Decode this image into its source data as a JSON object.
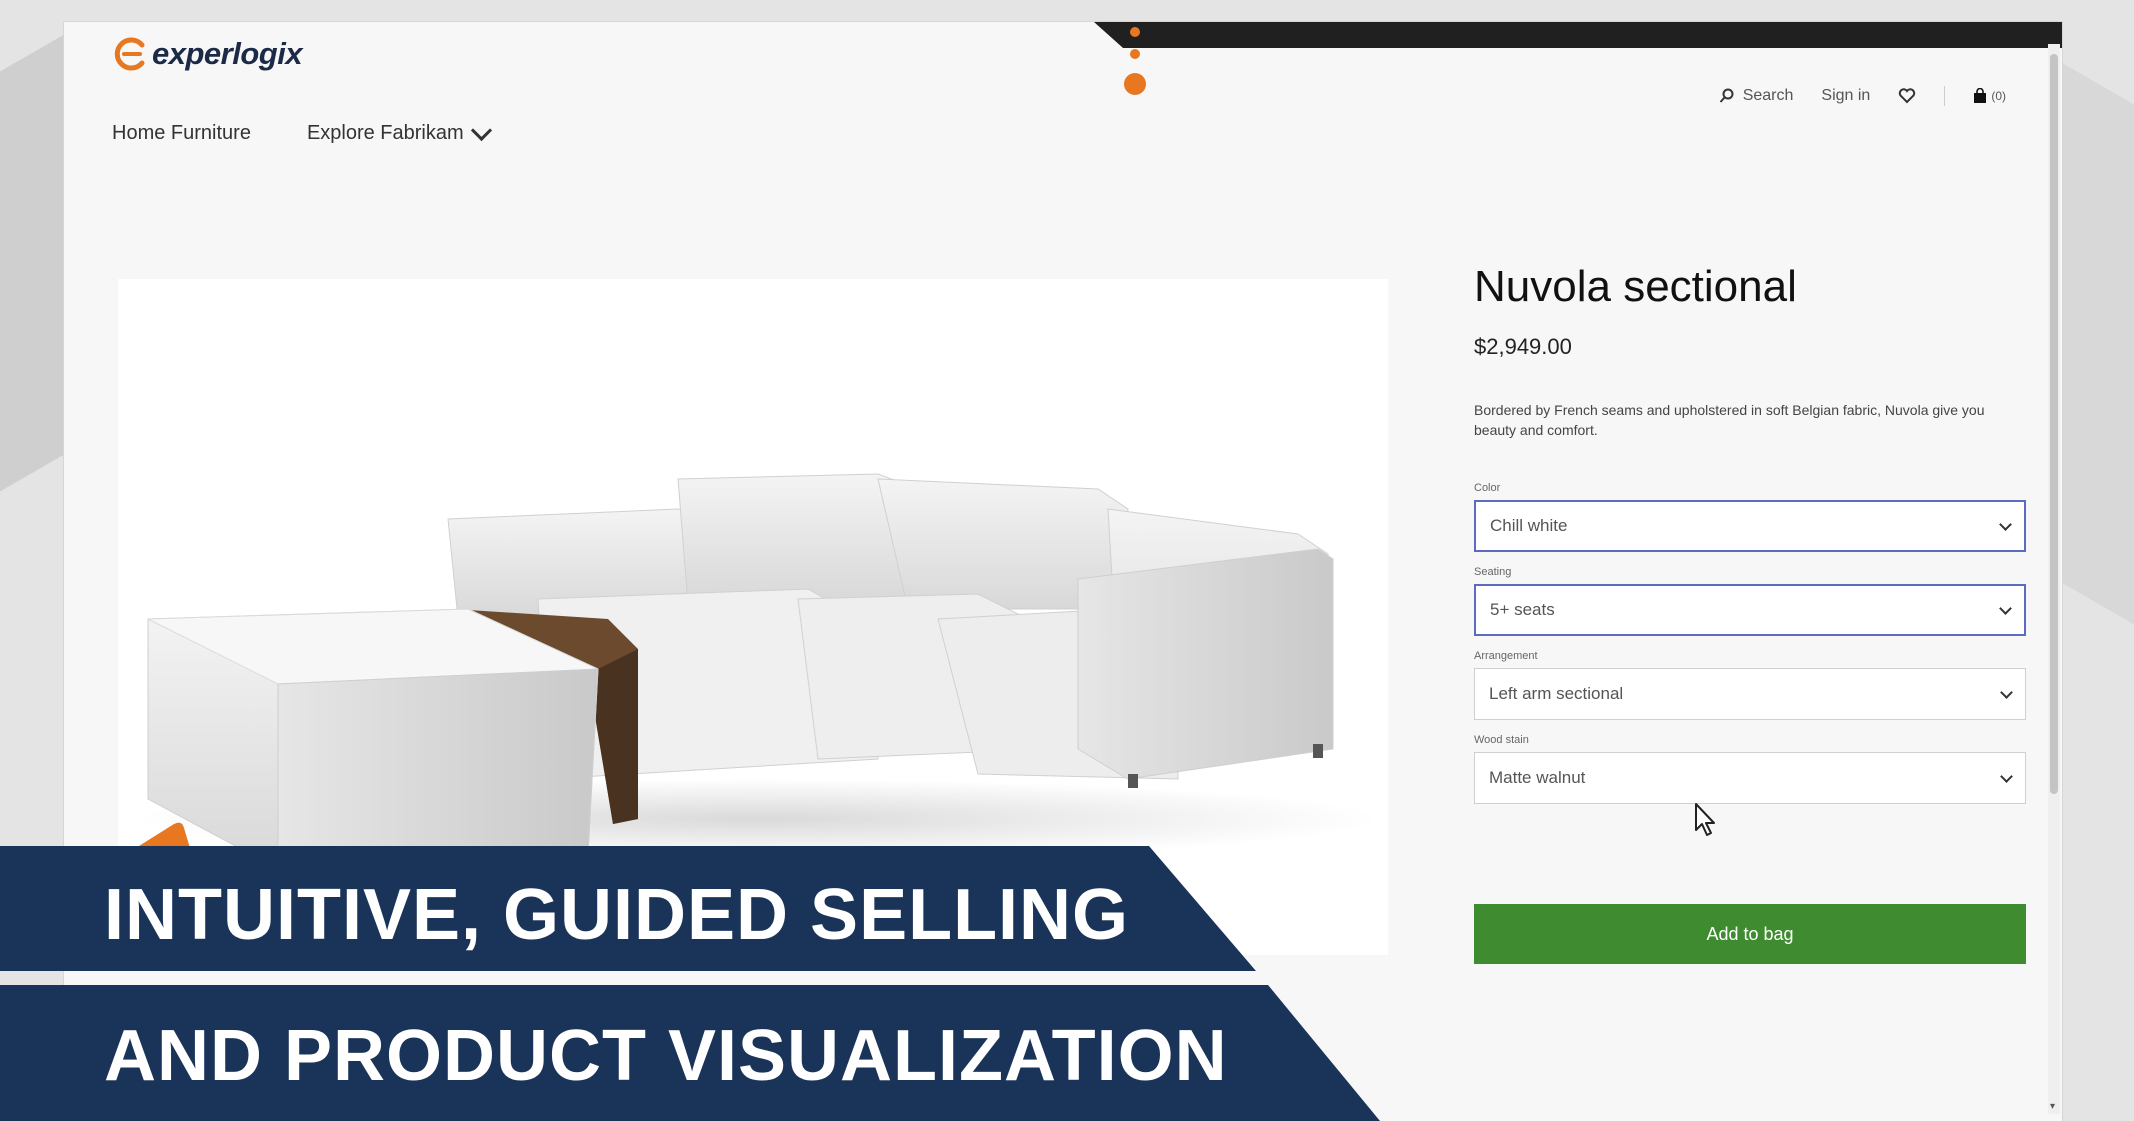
{
  "brand": {
    "logo_text": "experlogix",
    "accent": "#e87722"
  },
  "nav": {
    "items": [
      {
        "label": "Home Furniture"
      },
      {
        "label": "Explore Fabrikam"
      }
    ]
  },
  "utils": {
    "search_label": "Search",
    "signin_label": "Sign in",
    "bag_count": "(0)"
  },
  "product": {
    "title": "Nuvola sectional",
    "price": "$2,949.00",
    "description": "Bordered by French seams and upholstered in soft Belgian fabric, Nuvola give you beauty and comfort.",
    "options": [
      {
        "label": "Color",
        "value": "Chill white"
      },
      {
        "label": "Seating",
        "value": "5+ seats"
      },
      {
        "label": "Arrangement",
        "value": "Left arm sectional"
      },
      {
        "label": "Wood stain",
        "value": "Matte walnut"
      }
    ],
    "add_label": "Add to bag",
    "add_color": "#3e8c2f"
  },
  "banner": {
    "line1": "INTUITIVE, GUIDED SELLING",
    "line2": "AND PRODUCT VISUALIZATION",
    "color": "#1a3459"
  }
}
